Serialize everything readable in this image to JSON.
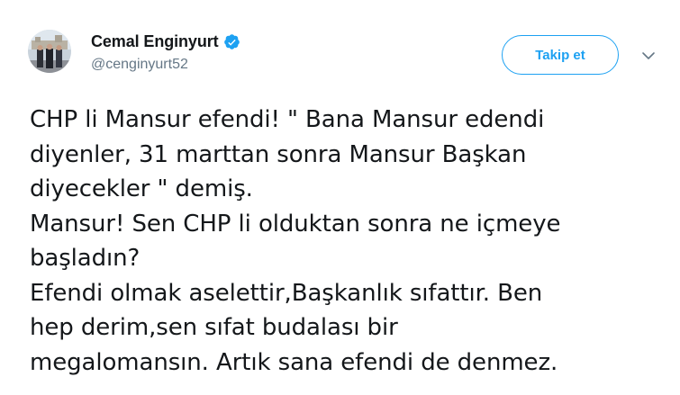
{
  "user": {
    "display_name": "Cemal Enginyurt",
    "handle": "@cenginyurt52",
    "verified": true
  },
  "follow_button": {
    "label": "Takip et"
  },
  "icons": {
    "verified": "verified-badge-icon",
    "menu": "chevron-down-icon"
  },
  "colors": {
    "accent": "#1da1f2",
    "text": "#14171a",
    "secondary": "#657786"
  },
  "tweet": {
    "lines": [
      "CHP li Mansur efendi! \" Bana Mansur edendi",
      "diyenler, 31 marttan sonra Mansur Başkan",
      "diyecekler \" demiş.",
      "Mansur! Sen CHP li olduktan sonra ne içmeye",
      "başladın?",
      "Efendi olmak aselettir,Başkanlık sıfattır. Ben",
      "hep derim,sen sıfat budalası bir",
      "megalomansın. Artık sana efendi de denmez."
    ]
  }
}
